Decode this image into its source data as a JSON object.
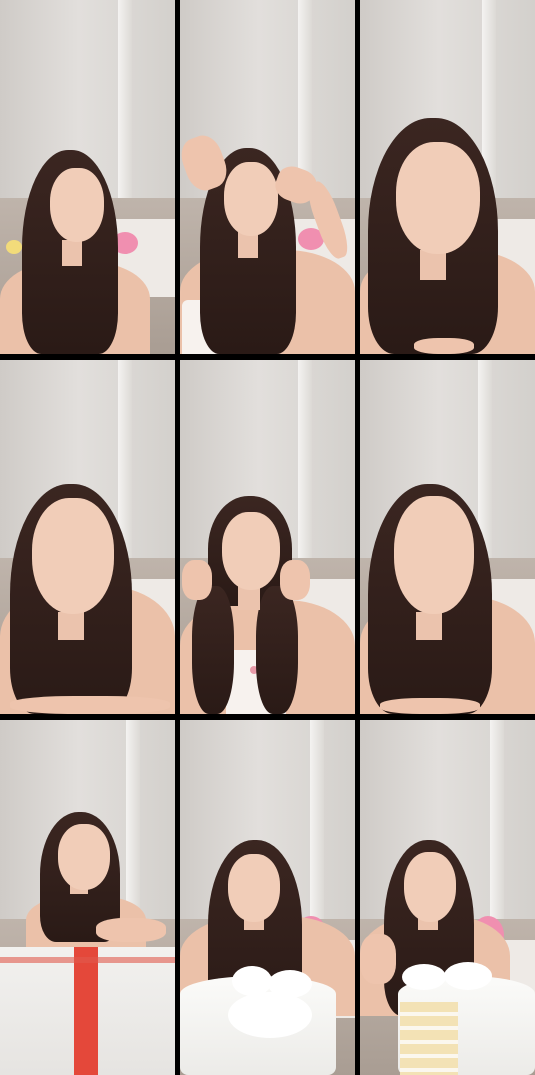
{
  "frames": [
    {
      "scene": "talking"
    },
    {
      "scene": "hands-raised"
    },
    {
      "scene": "close-up"
    },
    {
      "scene": "talking"
    },
    {
      "scene": "holding-hair"
    },
    {
      "scene": "smiling"
    },
    {
      "scene": "gift-box"
    },
    {
      "scene": "cake"
    },
    {
      "scene": "cake-sliced"
    }
  ],
  "colors": {
    "wall": "#e2dfdc",
    "sofa": "#a99d93",
    "hair": "#2a1a16",
    "skin": "#f1cdb8",
    "ribbon": "#e4483a",
    "pillow": "#f08fb0"
  }
}
